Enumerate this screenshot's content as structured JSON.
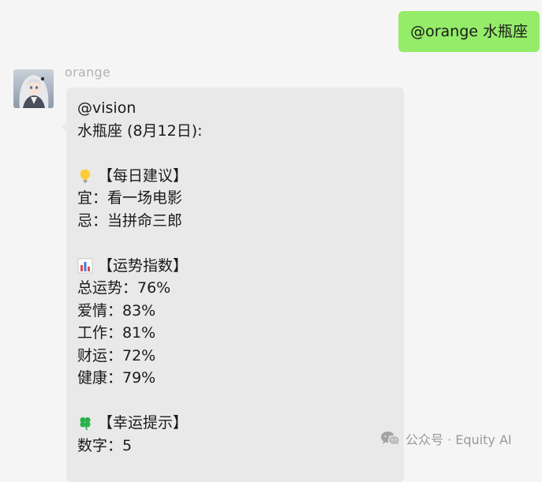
{
  "outgoing_message": {
    "text": "@orange 水瓶座"
  },
  "incoming_message": {
    "sender": "orange",
    "avatar_icon": "anime-girl-avatar",
    "lines": {
      "mention": "@vision",
      "header": "水瓶座 (8月12日):",
      "advice_title": "【每日建议】",
      "advice_good": "宜：看一场电影",
      "advice_bad": "忌：当拼命三郎",
      "fortune_title": "【运势指数】",
      "fortune_total": "总运势：76%",
      "fortune_love": "爱情：83%",
      "fortune_work": "工作：81%",
      "fortune_money": "财运：72%",
      "fortune_health": "健康：79%",
      "luck_title": "【幸运提示】",
      "luck_number": "数字：5"
    },
    "icons": {
      "advice": "lightbulb-icon",
      "fortune": "bar-chart-icon",
      "luck": "four-leaf-clover-icon"
    }
  },
  "watermark": {
    "text": "公众号 · Equity AI",
    "icon": "wechat-icon"
  },
  "colors": {
    "background": "#f5f5f5",
    "outgoing_bubble": "#95ec69",
    "incoming_bubble": "#e9e9e9",
    "sender_name": "#b2b2b2"
  }
}
